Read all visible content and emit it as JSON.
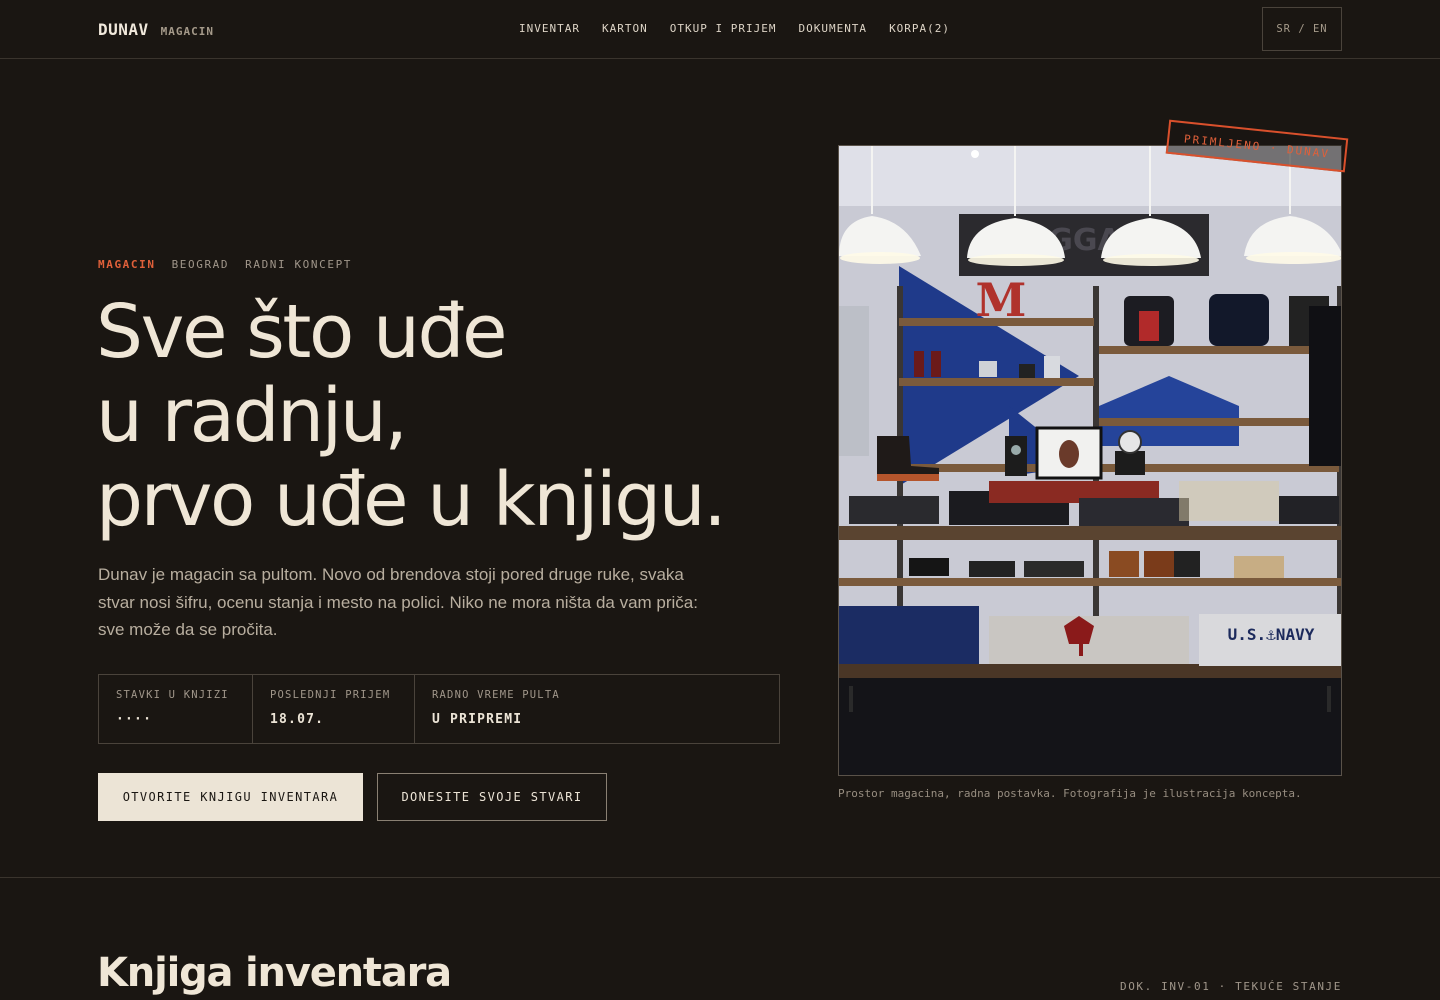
{
  "header": {
    "brand": "DUNAV",
    "brand_sub": "MAGACIN",
    "nav": [
      "INVENTAR",
      "KARTON",
      "OTKUP I PRIJEM",
      "DOKUMENTA",
      "KORPA(2)"
    ],
    "lang": "SR / EN"
  },
  "hero": {
    "eyebrow": {
      "accent": "MAGACIN",
      "city": "BEOGRAD",
      "tag": "RADNI KONCEPT"
    },
    "headline": [
      "Sve što uđe",
      "u radnju,",
      "prvo uđe u knjigu."
    ],
    "lead": "Dunav je magacin sa pultom. Novo od brendova stoji pored druge ruke, svaka stvar nosi šifru, ocenu stanja i mesto na polici. Niko ne mora ništa da vam priča: sve može da se pročita.",
    "stats": [
      {
        "label": "STAVKI U KNJIZI",
        "value": "····"
      },
      {
        "label": "POSLEDNJI PRIJEM",
        "value": "18.07."
      },
      {
        "label": "RADNO VREME PULTA",
        "value": "U PRIPREMI"
      }
    ],
    "primary_button": "OTVORITE KNJIGU INVENTARA",
    "secondary_button": "DONESITE SVOJE STVARI"
  },
  "photo": {
    "stamp": "PRIMLJENO · DUNAV",
    "caption": "Prostor magacina, radna postavka. Fotografija je ilustracija koncepta.",
    "sign_text": "BAGGAGE",
    "sign_letter": "M",
    "shirt_text": "U.S.⚓NAVY"
  },
  "inventory": {
    "title": "Knjiga inventara",
    "doc": "DOK. INV-01 · TEKUĆE STANJE"
  },
  "colors": {
    "background": "#1a1612",
    "text": "#ece4d6",
    "accent": "#e0603a"
  }
}
